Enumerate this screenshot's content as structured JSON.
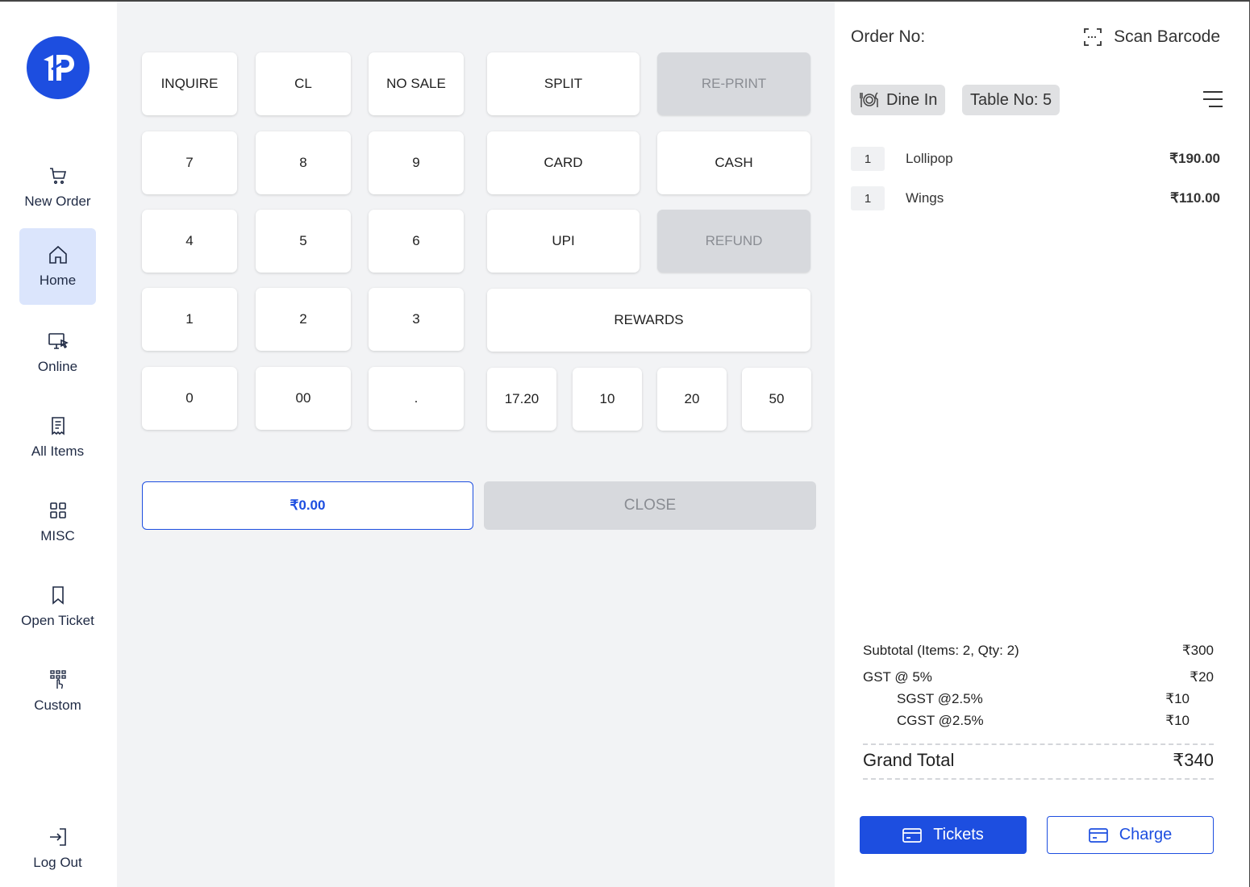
{
  "colors": {
    "accent": "#1d4ee0",
    "active_nav_bg": "#dbe5fc",
    "disabled_key_bg": "#d7d9dd",
    "keypad_bg": "#f2f3f5"
  },
  "sidebar": {
    "logo_icon": "brand-logo-icon",
    "items": [
      {
        "label": "New Order",
        "icon": "cart-icon"
      },
      {
        "label": "Home",
        "icon": "home-icon",
        "active": true
      },
      {
        "label": "Online",
        "icon": "monitor-cursor-icon"
      },
      {
        "label": "All Items",
        "icon": "receipt-icon"
      },
      {
        "label": "MISC",
        "icon": "grid-icon"
      },
      {
        "label": "Open Ticket",
        "icon": "bookmark-icon"
      },
      {
        "label": "Custom",
        "icon": "keypad-touch-icon"
      }
    ],
    "logout": {
      "label": "Log Out",
      "icon": "logout-icon"
    }
  },
  "keypad": {
    "function_keys": {
      "inquire": "INQUIRE",
      "cl": "CL",
      "no_sale": "NO SALE",
      "split": "SPLIT",
      "reprint": "RE-PRINT"
    },
    "digits": {
      "seven": "7",
      "eight": "8",
      "nine": "9",
      "four": "4",
      "five": "5",
      "six": "6",
      "one": "1",
      "two": "2",
      "three": "3",
      "zero": "0",
      "double_zero": "00",
      "dot": "."
    },
    "payment": {
      "card": "CARD",
      "cash": "CASH",
      "upi": "UPI",
      "refund": "REFUND",
      "rewards": "REWARDS"
    },
    "quick_amounts": [
      "17.20",
      "10",
      "20",
      "50"
    ],
    "amount_display": "₹0.00",
    "close_label": "CLOSE"
  },
  "order": {
    "order_no_label": "Order No:",
    "scan_label": "Scan Barcode",
    "dine_in_label": "Dine In",
    "table_label": "Table No: 5",
    "items": [
      {
        "qty": "1",
        "name": "Lollipop",
        "price": "₹190.00"
      },
      {
        "qty": "1",
        "name": "Wings",
        "price": "₹110.00"
      }
    ],
    "summary": {
      "subtotal_label": "Subtotal (Items: 2, Qty: 2)",
      "subtotal_value": "₹300",
      "gst_label": "GST @ 5%",
      "gst_value": "₹20",
      "sgst_label": "SGST @2.5%",
      "sgst_value": "₹10",
      "cgst_label": "CGST @2.5%",
      "cgst_value": "₹10",
      "grand_label": "Grand Total",
      "grand_value": "₹340"
    },
    "tickets_label": "Tickets",
    "charge_label": "Charge"
  }
}
